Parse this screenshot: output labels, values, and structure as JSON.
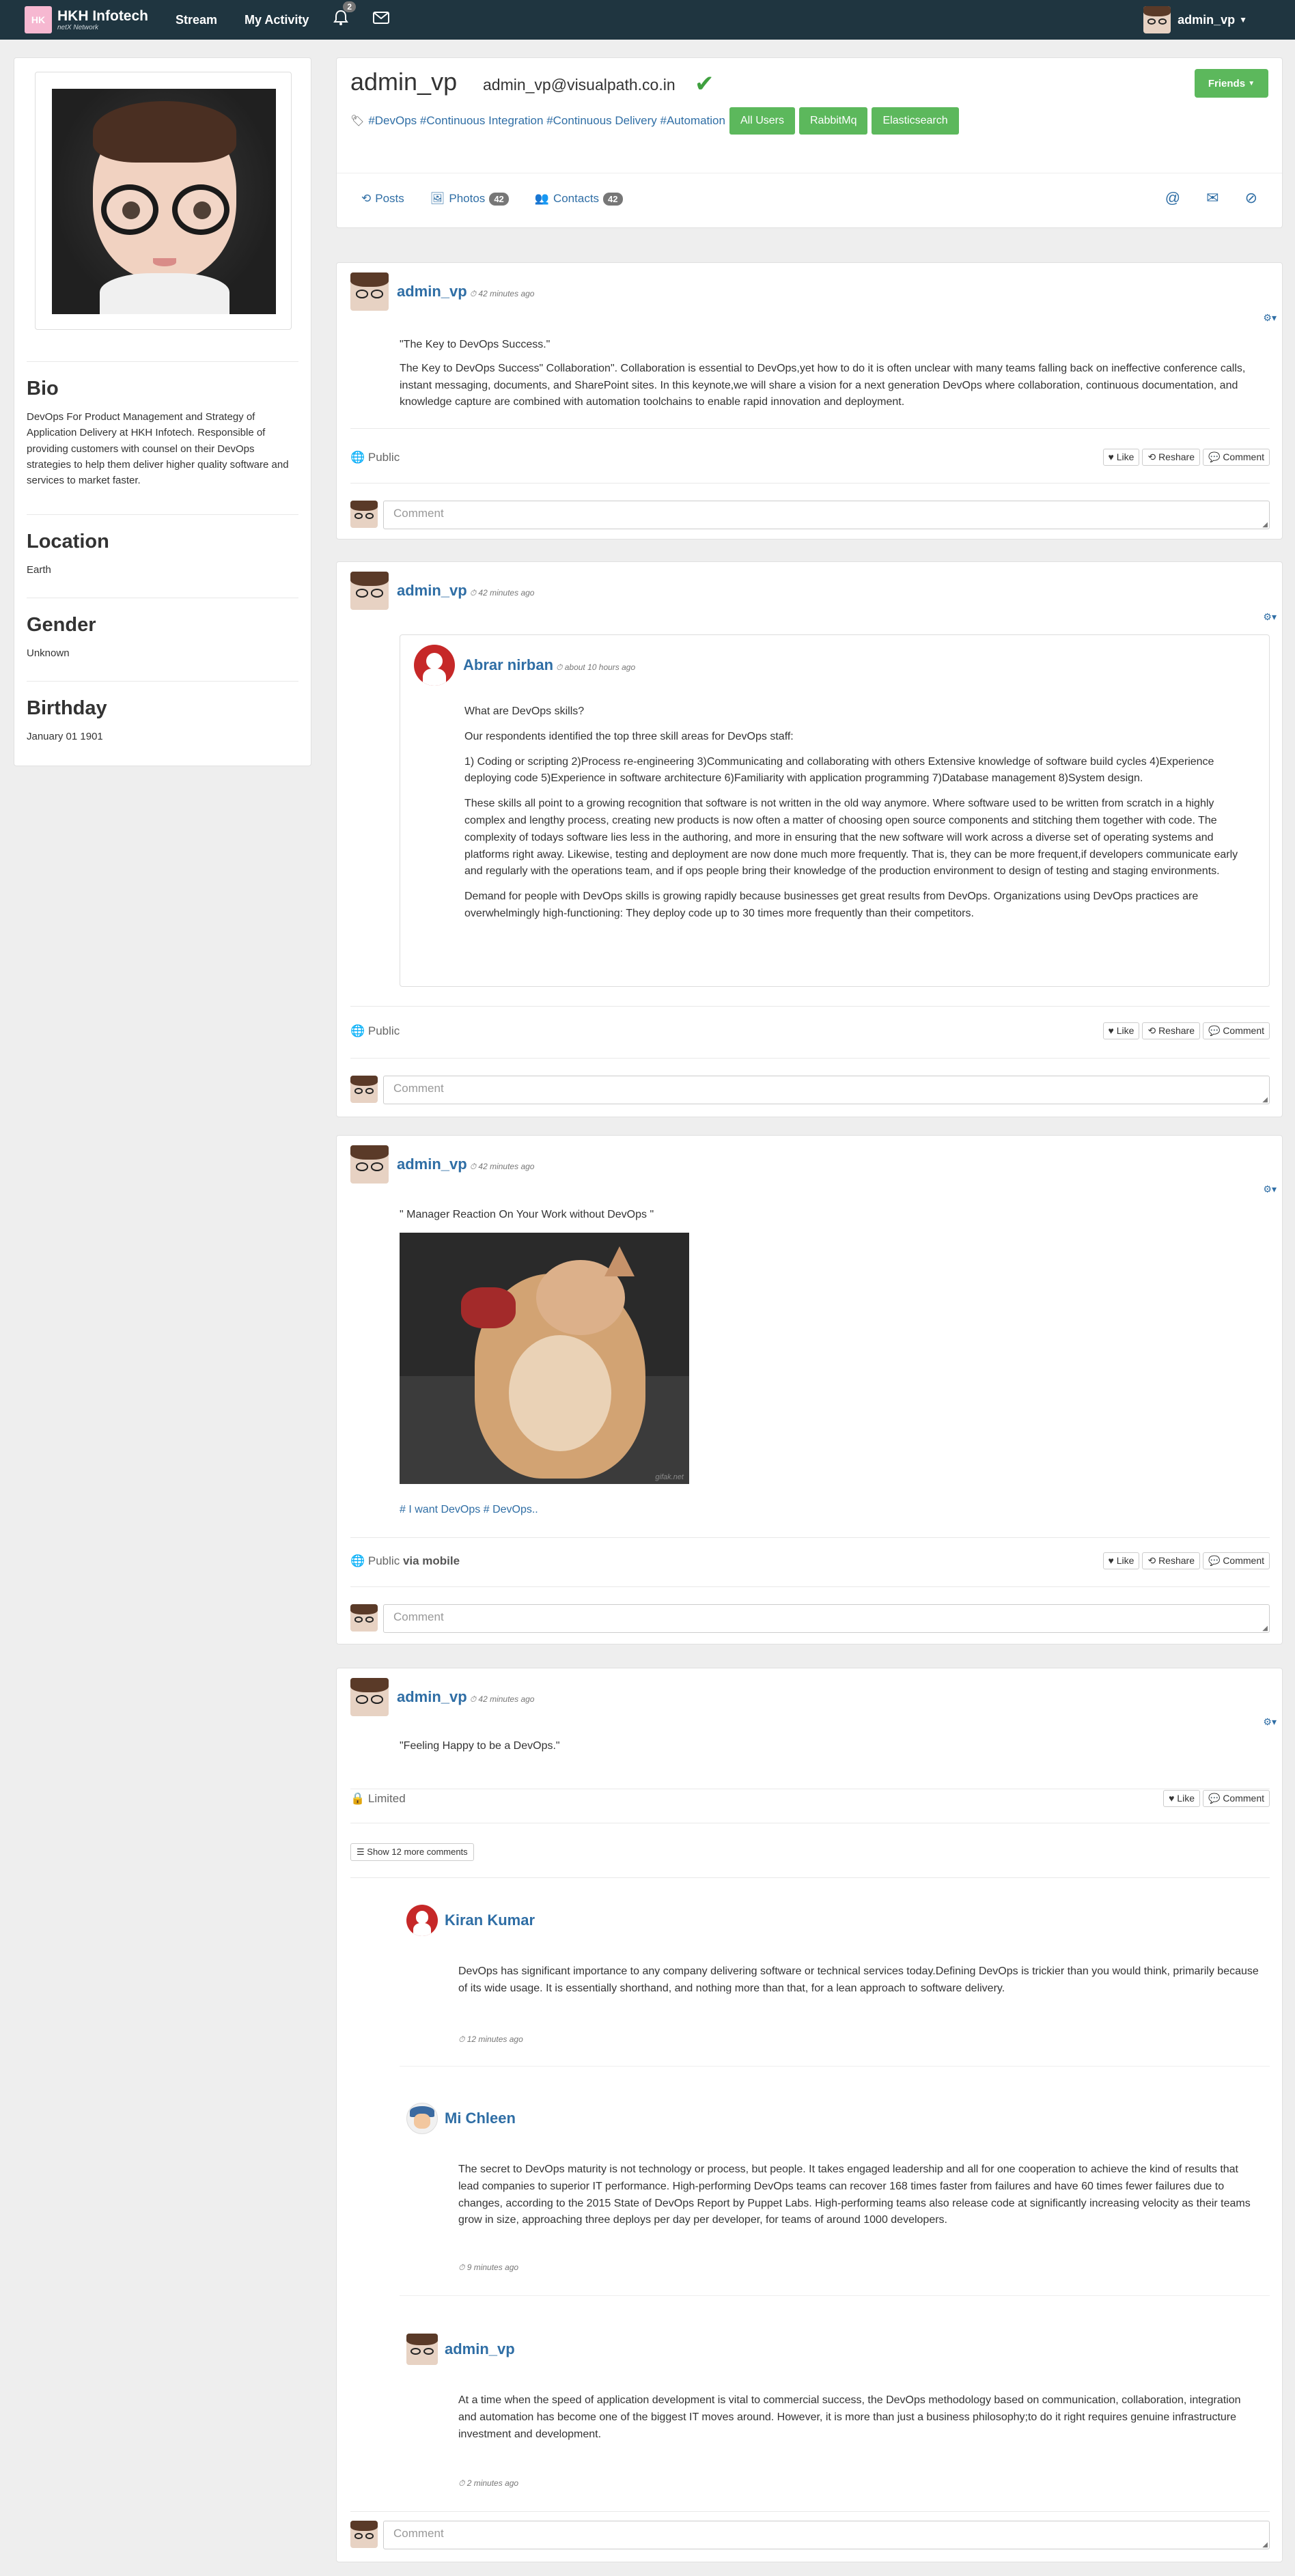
{
  "nav": {
    "brand": "HKH Infotech",
    "brand_sub": "netX Network",
    "stream": "Stream",
    "my_activity": "My Activity",
    "notif_count": "2",
    "user": "admin_vp"
  },
  "profile": {
    "bio_title": "Bio",
    "bio": "DevOps For Product Management and Strategy of Application Delivery at HKH Infotech. Responsible of providing customers with counsel on their DevOps strategies to help them deliver higher quality software and services to market faster.",
    "location_title": "Location",
    "location": "Earth",
    "gender_title": "Gender",
    "gender": "Unknown",
    "birthday_title": "Birthday",
    "birthday": "January 01 1901"
  },
  "header": {
    "name": "admin_vp",
    "email": "admin_vp@visualpath.co.in",
    "friends_btn": "Friends",
    "tags": [
      "#DevOps",
      "#Continuous Integration",
      "#Continuous Delivery",
      "#Automation"
    ],
    "aspects": [
      "All Users",
      "RabbitMq",
      "Elasticsearch"
    ],
    "tab_posts": "Posts",
    "tab_photos": "Photos",
    "photos_count": "42",
    "tab_contacts": "Contacts",
    "contacts_count": "42"
  },
  "actions": {
    "like": "Like",
    "reshare": "Reshare",
    "comment": "Comment",
    "comment_placeholder": "Comment"
  },
  "posts": [
    {
      "author": "admin_vp",
      "time": "42 minutes ago",
      "title": "\"The Key to DevOps Success.\"",
      "text": "The Key to DevOps Success\" Collaboration\". Collaboration is essential to DevOps,yet how to do it is often unclear with many teams falling back on ineffective conference calls, instant messaging, documents, and SharePoint sites. In this keynote,we will share a vision for a next generation DevOps where collaboration, continuous documentation, and knowledge capture are combined with automation toolchains to enable rapid innovation and deployment.",
      "privacy": "Public"
    },
    {
      "author": "admin_vp",
      "time": "42 minutes ago",
      "reshare_author": "Abrar nirban",
      "reshare_time": "about 10 hours ago",
      "p1": "What are DevOps skills?",
      "p2": "Our respondents identified the top three skill areas for DevOps staff:",
      "p3": "1) Coding or scripting 2)Process re-engineering 3)Communicating and collaborating with others Extensive knowledge of software build cycles 4)Experience deploying code 5)Experience in software architecture 6)Familiarity with application programming 7)Database management 8)System design.",
      "p4": "These skills all point to a growing recognition that software is not written in the old way anymore. Where software used to be written from scratch in a highly complex and lengthy process, creating new products is now often a matter of choosing open source components and stitching them together with code. The complexity of todays software lies less in the authoring, and more in ensuring that the new software will work across a diverse set of operating systems and platforms right away. Likewise, testing and deployment are now done much more frequently. That is, they can be more frequent,if developers communicate early and regularly with the operations team, and if ops people bring their knowledge of the production environment to design of testing and staging environments.",
      "p5": "Demand for people with DevOps skills is growing rapidly because businesses get great results from DevOps. Organizations using DevOps practices are overwhelmingly high-functioning: They deploy code up to 30 times more frequently than their competitors.",
      "privacy": "Public"
    },
    {
      "author": "admin_vp",
      "time": "42 minutes ago",
      "title": "\" Manager Reaction On Your Work without DevOps \"",
      "watermark": "gifak.net",
      "hashtags": "# I want DevOps # DevOps..",
      "privacy": "Public",
      "via": "via mobile"
    },
    {
      "author": "admin_vp",
      "time": "42 minutes ago",
      "text": "\"Feeling Happy to be a DevOps.\"",
      "privacy": "Limited",
      "more_comments": "Show 12 more comments",
      "comments": [
        {
          "author": "Kiran Kumar",
          "text": "DevOps has significant importance to any company delivering software or technical services today.Defining DevOps is trickier than you would think, primarily because of its wide usage. It is essentially shorthand, and nothing more than that, for a lean approach to software delivery.",
          "time": "12 minutes ago"
        },
        {
          "author": "Mi Chleen",
          "text": "The secret to DevOps maturity is not technology or process, but people. It takes engaged leadership and all for one cooperation to achieve the kind of results that lead companies to superior IT performance. High-performing DevOps teams can recover 168 times faster from failures and have 60 times fewer failures due to changes, according to the 2015 State of DevOps Report by Puppet Labs. High-performing teams also release code at significantly increasing velocity as their teams grow in size, approaching three deploys per day per developer, for teams of around 1000 developers.",
          "time": "9 minutes ago"
        },
        {
          "author": "admin_vp",
          "text": "At a time when the speed of application development is vital to commercial success, the DevOps methodology based on communication, collaboration, integration and automation has become one of the biggest IT moves around. However, it is more than just a business philosophy;to do it right requires genuine infrastructure investment and development.",
          "time": "2 minutes ago"
        }
      ]
    }
  ]
}
